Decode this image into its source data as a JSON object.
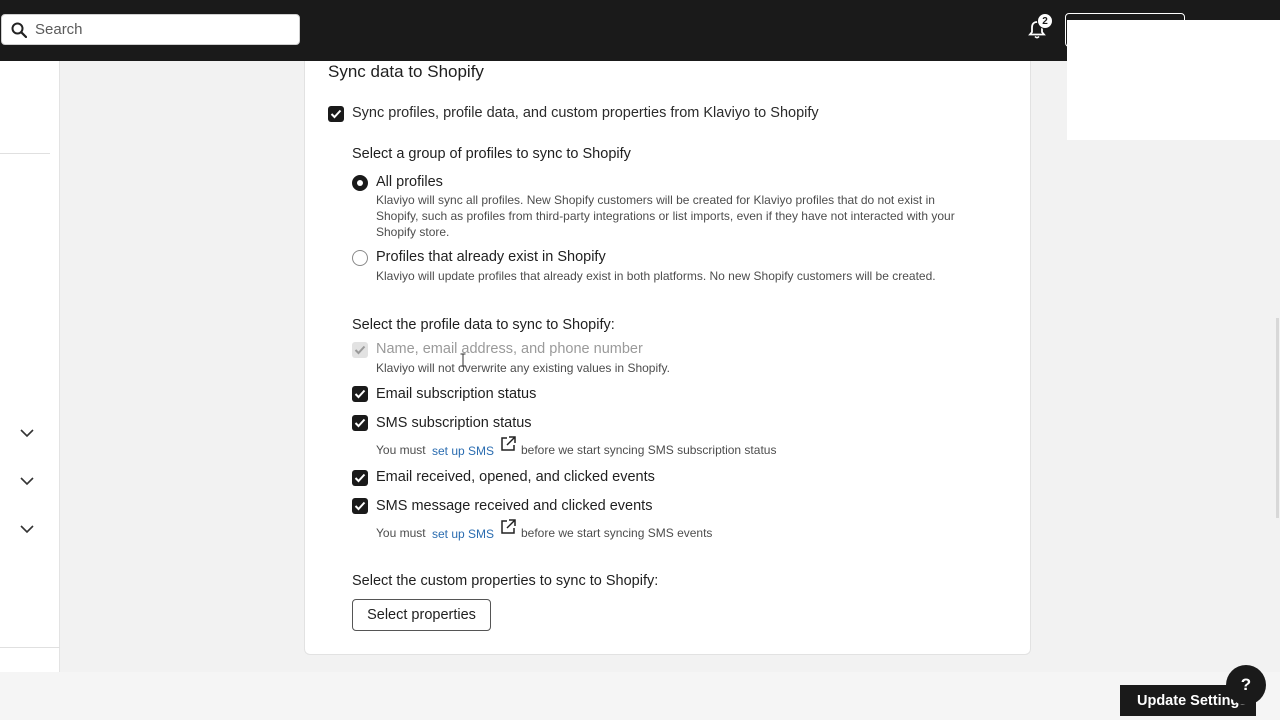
{
  "topbar": {
    "search_placeholder": "Search",
    "notification_count": "2"
  },
  "card": {
    "title": "Sync data to Shopify",
    "main_checkbox_label": "Sync profiles, profile data, and custom properties from Klaviyo to Shopify",
    "group_heading": "Select a group of profiles to sync to Shopify",
    "radio_all_label": "All profiles",
    "radio_all_desc_1": "Klaviyo will sync all profiles. New Shopify customers will be created for Klaviyo profiles that do not exist in",
    "radio_all_desc_2": "Shopify, such as profiles from third-party integrations or list imports, even if they have not interacted with your",
    "radio_all_desc_3": "Shopify store.",
    "radio_existing_label": "Profiles that already exist in Shopify",
    "radio_existing_desc": "Klaviyo will update profiles that already exist in both platforms. No new Shopify customers will be created.",
    "profile_data_heading": "Select the profile data to sync to Shopify:",
    "name_email_label": "Name, email address, and phone number",
    "name_email_desc": "Klaviyo will not overwrite any existing values in Shopify.",
    "email_sub_label": "Email subscription status",
    "sms_sub_label": "SMS subscription status",
    "sms_sub_note_prefix": "You must",
    "sms_sub_note_link": "set up SMS",
    "sms_sub_note_suffix": "before we start syncing SMS subscription status",
    "email_events_label": "Email received, opened, and clicked events",
    "sms_events_label": "SMS message received and clicked events",
    "sms_events_note_prefix": "You must",
    "sms_events_note_link": "set up SMS",
    "sms_events_note_suffix": "before we start syncing SMS events",
    "custom_props_heading": "Select the custom properties to sync to Shopify:",
    "select_props_button": "Select properties"
  },
  "footer": {
    "update_button": "Update Settings",
    "help_button": "?"
  },
  "colors": {
    "topbar": "#1a1a1a",
    "link": "#2a6cb0",
    "checkbox": "#1a1a1a"
  }
}
